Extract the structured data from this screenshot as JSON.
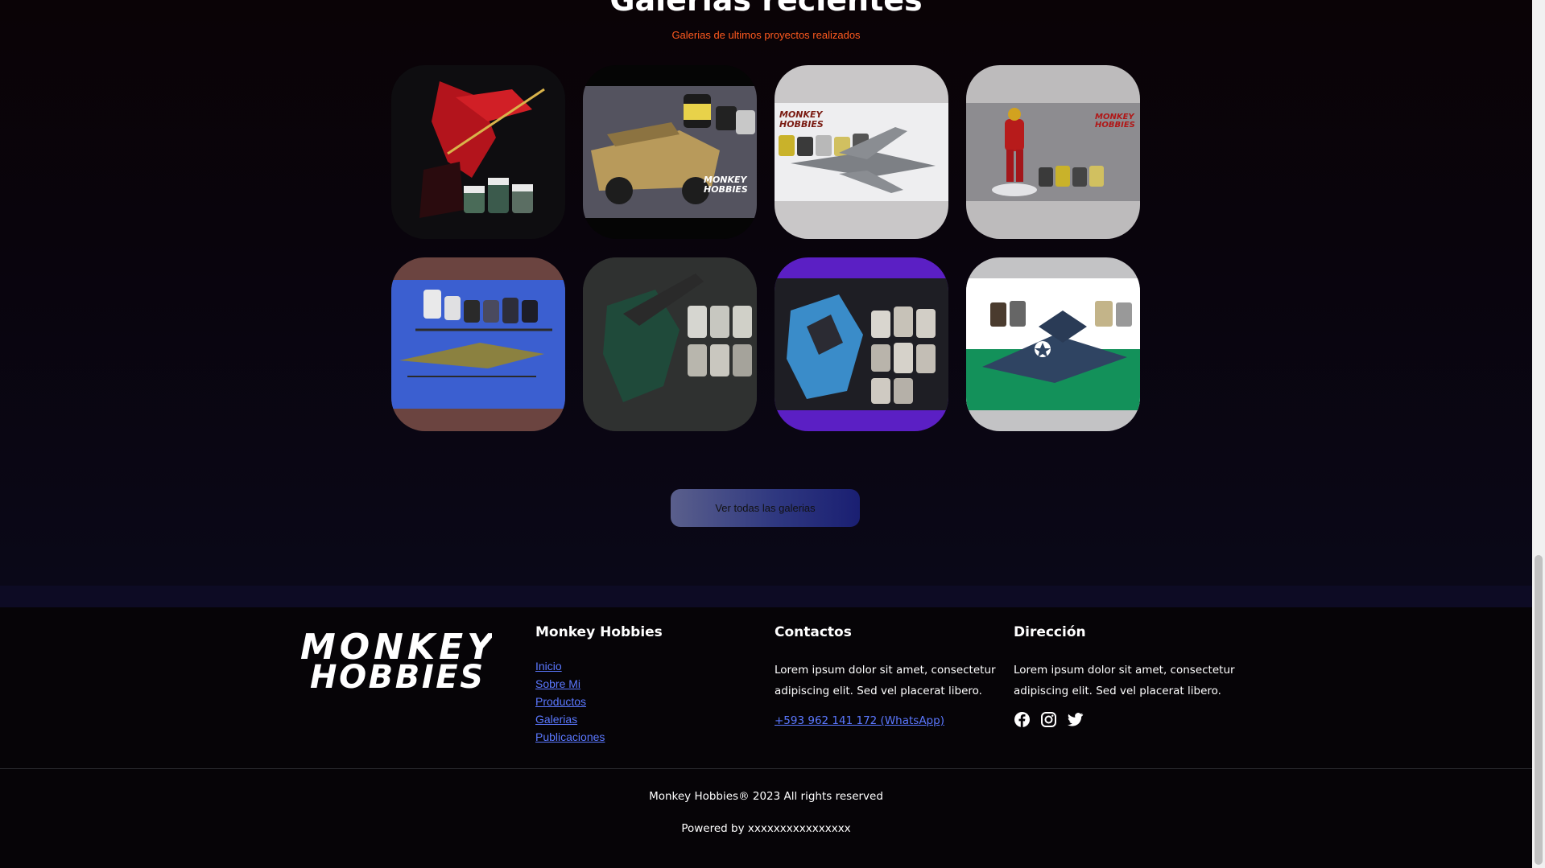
{
  "gallery": {
    "title": "Galerías recientes",
    "subtitle": "Galerias de ultimos proyectos realizados",
    "brand_text": "MONKEY HOBBIES",
    "items": [
      {
        "name": "gallery-tile-red-mecha",
        "bg": "#0b0b0c",
        "photo_bg": "#101014"
      },
      {
        "name": "gallery-tile-desert-jeep",
        "bg": "#050505",
        "photo_bg": "#4b4a57"
      },
      {
        "name": "gallery-tile-jet-fighter",
        "bg": "#c9c7c8",
        "photo_bg": "#e6e6e8"
      },
      {
        "name": "gallery-tile-iron-figure",
        "bg": "#bdbbbc",
        "photo_bg": "#8b8a8e"
      },
      {
        "name": "gallery-tile-helicopter",
        "bg": "#6b4440",
        "photo_bg": "#3d5fd1"
      },
      {
        "name": "gallery-tile-green-mecha",
        "bg": "#2b2c2c",
        "photo_bg": "#2e302f"
      },
      {
        "name": "gallery-tile-blue-robot",
        "bg": "#5b1fc4",
        "photo_bg": "#1d1d22"
      },
      {
        "name": "gallery-tile-corsair-plane",
        "bg": "#c3c3c5",
        "photo_bg": "#159053"
      }
    ],
    "view_all_label": "Ver todas las galerias"
  },
  "footer": {
    "logo_text_top": "MONKEY",
    "logo_text_bottom": "HOBBIES",
    "brand_title": "Monkey Hobbies",
    "links": [
      "Inicio",
      "Sobre Mi",
      "Productos",
      "Galerias",
      "Publicaciones"
    ],
    "contacts_title": "Contactos",
    "contacts_text": "Lorem ipsum dolor sit amet, consectetur adipiscing elit. Sed vel placerat libero.",
    "phone": "+593 962 141 172 (WhatsApp)",
    "address_title": "Dirección",
    "address_text": "Lorem ipsum dolor sit amet, consectetur adipiscing elit. Sed vel placerat libero.",
    "social_icons": [
      "facebook-icon",
      "instagram-icon",
      "twitter-icon"
    ],
    "copyright": "Monkey Hobbies® 2023 All rights reserved",
    "powered_by": "Powered by xxxxxxxxxxxxxxxx"
  },
  "colors": {
    "accent": "#ff5a1f",
    "link": "#5b78ff",
    "band": "#0d0b24"
  }
}
